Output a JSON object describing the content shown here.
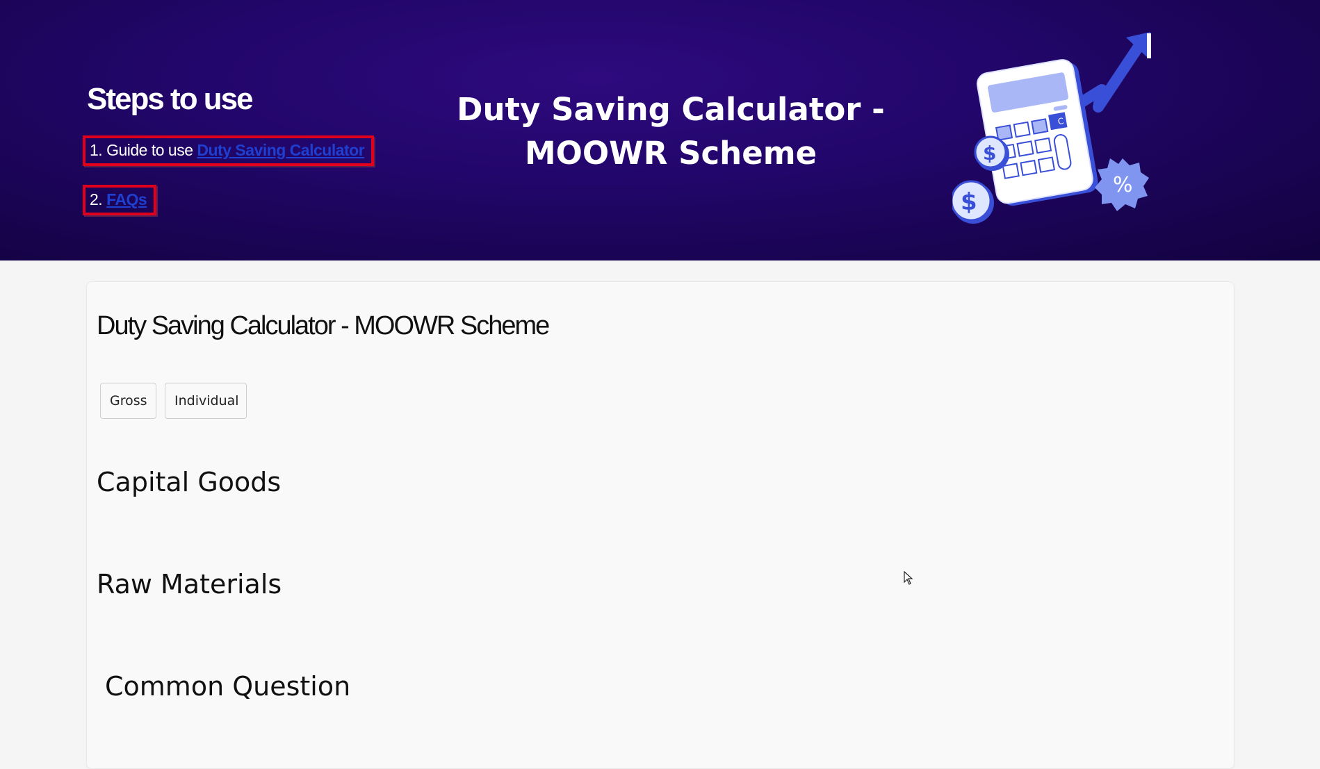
{
  "hero": {
    "steps_title": "Steps to use",
    "step1_prefix": "1. Guide to use ",
    "step1_link": "Duty Saving Calculator",
    "step2_prefix": "2. ",
    "step2_link": "FAQs",
    "title_line1": "Duty Saving Calculator -",
    "title_line2": "MOOWR Scheme",
    "illustration_icon": "calculator-growth-icon",
    "highlight_color": "#e0001b",
    "link_color": "#1f3fd1"
  },
  "calculator": {
    "title": "Duty Saving Calculator - MOOWR Scheme",
    "modes": [
      "Gross",
      "Individual"
    ],
    "sections": {
      "capital_goods": "Capital Goods",
      "raw_materials": "Raw Materials",
      "common_question": "Common Question"
    }
  },
  "colors": {
    "hero_bg": "#22066a",
    "page_bg": "#f5f5f5"
  }
}
